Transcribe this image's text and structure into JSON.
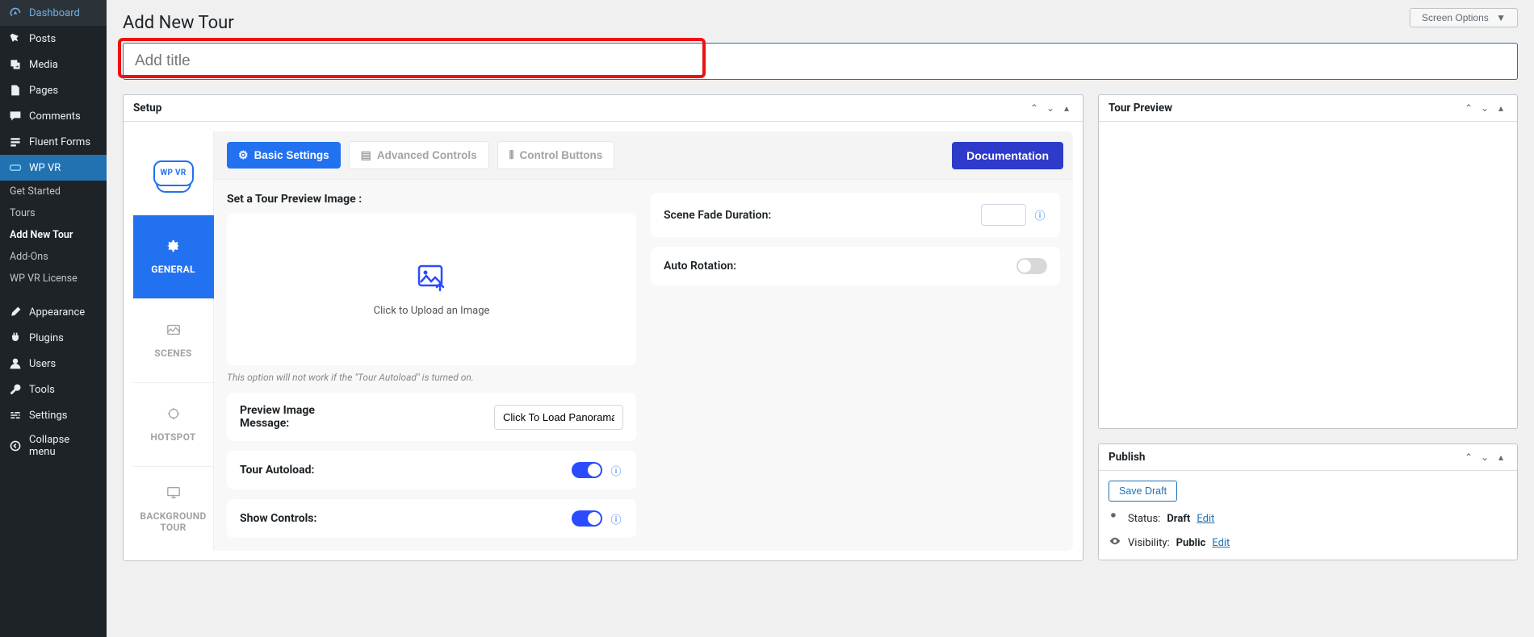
{
  "sidebar": {
    "items": [
      {
        "icon": "tachometer",
        "label": "Dashboard"
      },
      {
        "icon": "pin",
        "label": "Posts"
      },
      {
        "icon": "media",
        "label": "Media"
      },
      {
        "icon": "pages",
        "label": "Pages"
      },
      {
        "icon": "comment",
        "label": "Comments"
      },
      {
        "icon": "form",
        "label": "Fluent Forms"
      },
      {
        "icon": "vr",
        "label": "WP VR"
      }
    ],
    "subitems": [
      {
        "label": "Get Started"
      },
      {
        "label": "Tours"
      },
      {
        "label": "Add New Tour"
      },
      {
        "label": "Add-Ons"
      },
      {
        "label": "WP VR License"
      }
    ],
    "lower": [
      {
        "icon": "brush",
        "label": "Appearance"
      },
      {
        "icon": "plug",
        "label": "Plugins"
      },
      {
        "icon": "user",
        "label": "Users"
      },
      {
        "icon": "tool",
        "label": "Tools"
      },
      {
        "icon": "sliders",
        "label": "Settings"
      },
      {
        "icon": "collapse",
        "label": "Collapse menu"
      }
    ]
  },
  "header": {
    "title": "Add New Tour",
    "screen_options": "Screen Options"
  },
  "title_input": {
    "placeholder": "Add title",
    "value": ""
  },
  "setup": {
    "box_title": "Setup",
    "logo_text": "WP VR",
    "sidetabs": [
      {
        "label": "GENERAL",
        "icon": "gear"
      },
      {
        "label": "SCENES",
        "icon": "image"
      },
      {
        "label": "HOTSPOT",
        "icon": "target"
      },
      {
        "label": "BACKGROUND TOUR",
        "icon": "monitor"
      }
    ],
    "topbtns": {
      "basic": "Basic Settings",
      "advanced": "Advanced Controls",
      "control": "Control Buttons",
      "doc": "Documentation"
    },
    "preview_section_title": "Set a Tour Preview Image :",
    "upload_text": "Click to Upload an Image",
    "upload_hint": "This option will not work if the \"Tour Autoload\" is turned on.",
    "preview_msg_label": "Preview Image Message:",
    "preview_msg_value": "Click To Load Panorama",
    "autoload_label": "Tour Autoload:",
    "showcontrols_label": "Show Controls:",
    "fade_label": "Scene Fade Duration:",
    "fade_value": "",
    "rotation_label": "Auto Rotation:"
  },
  "tour_preview": {
    "box_title": "Tour Preview"
  },
  "publish": {
    "box_title": "Publish",
    "save_draft": "Save Draft",
    "status_label": "Status:",
    "status_value": "Draft",
    "visibility_label": "Visibility:",
    "visibility_value": "Public",
    "edit": "Edit"
  }
}
